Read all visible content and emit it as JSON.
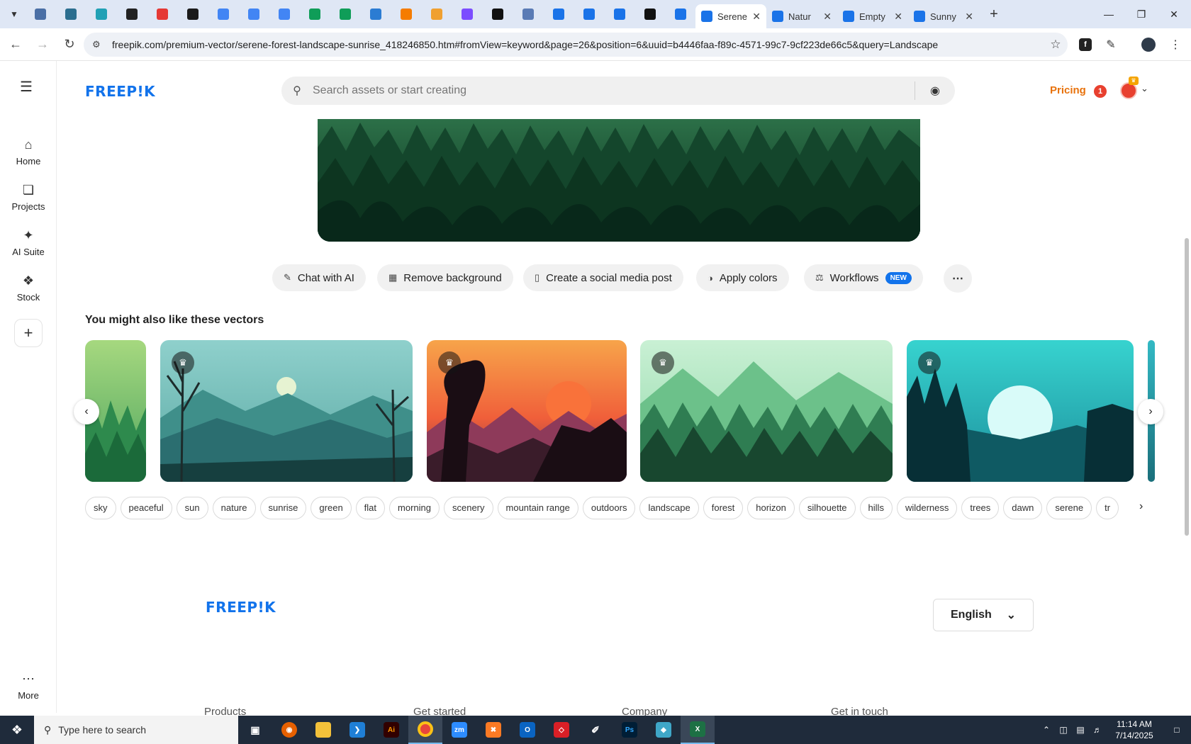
{
  "browser": {
    "pinned_tabs": [
      {
        "icon": "globe-icon",
        "color": "#4a6fa5"
      },
      {
        "icon": "vpn-icon",
        "color": "#2b6e8f"
      },
      {
        "icon": "arrow-app-icon",
        "color": "#21a1b5"
      },
      {
        "icon": "openai-icon",
        "color": "#222222"
      },
      {
        "icon": "youtube-icon",
        "color": "#e53935"
      },
      {
        "icon": "bolt-icon",
        "color": "#1b1b1b"
      },
      {
        "icon": "docs-icon",
        "color": "#4285f4"
      },
      {
        "icon": "docs-icon",
        "color": "#4285f4"
      },
      {
        "icon": "docs-icon",
        "color": "#4285f4"
      },
      {
        "icon": "sheets-icon",
        "color": "#0f9d58"
      },
      {
        "icon": "sheets-icon",
        "color": "#0f9d58"
      },
      {
        "icon": "word-icon",
        "color": "#2b7cd3"
      },
      {
        "icon": "xampp-icon",
        "color": "#f57c00"
      },
      {
        "icon": "vue-icon",
        "color": "#f0a030"
      },
      {
        "icon": "braces-icon",
        "color": "#7c4dff"
      },
      {
        "icon": "a-icon",
        "color": "#111111"
      },
      {
        "icon": "grid-icon",
        "color": "#5a7bb5"
      },
      {
        "icon": "forms-icon",
        "color": "#1a73e8"
      },
      {
        "icon": "forms-icon",
        "color": "#1a73e8"
      },
      {
        "icon": "forms-icon",
        "color": "#1a73e8"
      },
      {
        "icon": "medium-icon",
        "color": "#111111"
      },
      {
        "icon": "forms-icon",
        "color": "#1a73e8"
      }
    ],
    "tabs": [
      {
        "title": "Serene",
        "active": true
      },
      {
        "title": "Natur",
        "active": false
      },
      {
        "title": "Empty",
        "active": false
      },
      {
        "title": "Sunny",
        "active": false
      }
    ],
    "url": "freepik.com/premium-vector/serene-forest-landscape-sunrise_418246850.htm#fromView=keyword&page=26&position=6&uuid=b4446faa-f89c-4571-99c7-9cf223de66c5&query=Landscape"
  },
  "sidebar": {
    "items": [
      {
        "label": "Home",
        "icon": "home-icon"
      },
      {
        "label": "Projects",
        "icon": "projects-icon"
      },
      {
        "label": "AI Suite",
        "icon": "sparkle-icon"
      },
      {
        "label": "Stock",
        "icon": "stock-icon"
      }
    ],
    "more_label": "More"
  },
  "header": {
    "logo": "FREEP!K",
    "search_placeholder": "Search assets or start creating",
    "pricing": "Pricing",
    "notification_count": "1"
  },
  "actions": [
    {
      "label": "Chat with AI",
      "icon": "chat-icon"
    },
    {
      "label": "Remove background",
      "icon": "remove-bg-icon"
    },
    {
      "label": "Create a social media post",
      "icon": "phone-icon"
    },
    {
      "label": "Apply colors",
      "icon": "palette-icon"
    },
    {
      "label": "Workflows",
      "icon": "workflow-icon",
      "badge": "NEW"
    }
  ],
  "related": {
    "title": "You might also like these vectors"
  },
  "tags": [
    "sky",
    "peaceful",
    "sun",
    "nature",
    "sunrise",
    "green",
    "flat",
    "morning",
    "scenery",
    "mountain range",
    "outdoors",
    "landscape",
    "forest",
    "horizon",
    "silhouette",
    "hills",
    "wilderness",
    "trees",
    "dawn",
    "serene",
    "tr"
  ],
  "footer": {
    "logo": "FREEP!K",
    "language": "English",
    "columns": [
      "Products",
      "Get started",
      "Company",
      "Get in touch"
    ]
  },
  "taskbar": {
    "search_placeholder": "Type here to search",
    "time": "11:14 AM",
    "date": "7/14/2025"
  }
}
